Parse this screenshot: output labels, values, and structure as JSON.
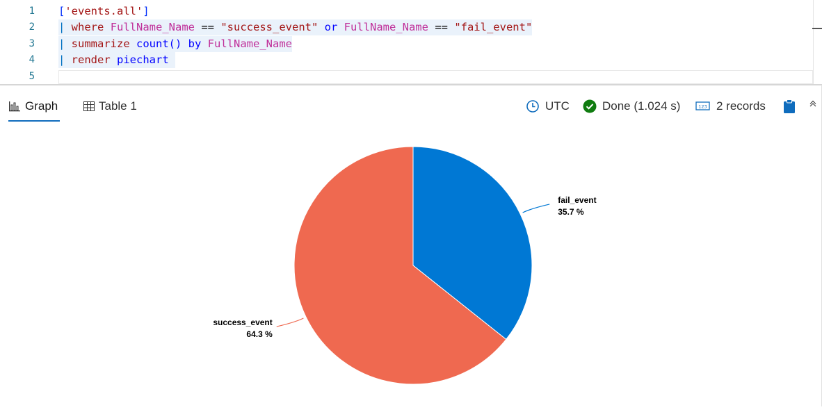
{
  "editor": {
    "line_numbers": [
      "1",
      "2",
      "3",
      "4",
      "5"
    ],
    "line1": {
      "open": "[",
      "table": "'events.all'",
      "close": "]"
    },
    "line2": {
      "pipe": "| ",
      "where": "where",
      "sp1": " ",
      "field1": "FullName_Name",
      "eq1": " == ",
      "val1": "\"success_event\"",
      "or": " or ",
      "field2": "FullName_Name",
      "eq2": " == ",
      "val2": "\"fail_event\""
    },
    "line3": {
      "pipe": "| ",
      "summarize": "summarize",
      "sp1": " ",
      "count": "count()",
      "by": " by ",
      "field": "FullName_Name"
    },
    "line4": {
      "pipe": "| ",
      "render": "render",
      "sp1": " ",
      "piechart": "piechart",
      "trail": " "
    }
  },
  "toolbar": {
    "tabs": [
      {
        "label": "Graph",
        "icon": "bar-chart-icon",
        "active": true
      },
      {
        "label": "Table 1",
        "icon": "table-grid-icon",
        "active": false
      }
    ],
    "timezone": "UTC",
    "status": "Done (1.024 s)",
    "records": "2 records",
    "status_color": "#107c10",
    "accent_color": "#0f6cbd"
  },
  "chart_data": {
    "type": "pie",
    "slices": [
      {
        "label": "fail_event",
        "value": 35.7,
        "display": "35.7 %",
        "color": "#0078d4"
      },
      {
        "label": "success_event",
        "value": 64.3,
        "display": "64.3 %",
        "color": "#ef6950"
      }
    ],
    "start_angle_deg": 0,
    "legend": "none"
  }
}
